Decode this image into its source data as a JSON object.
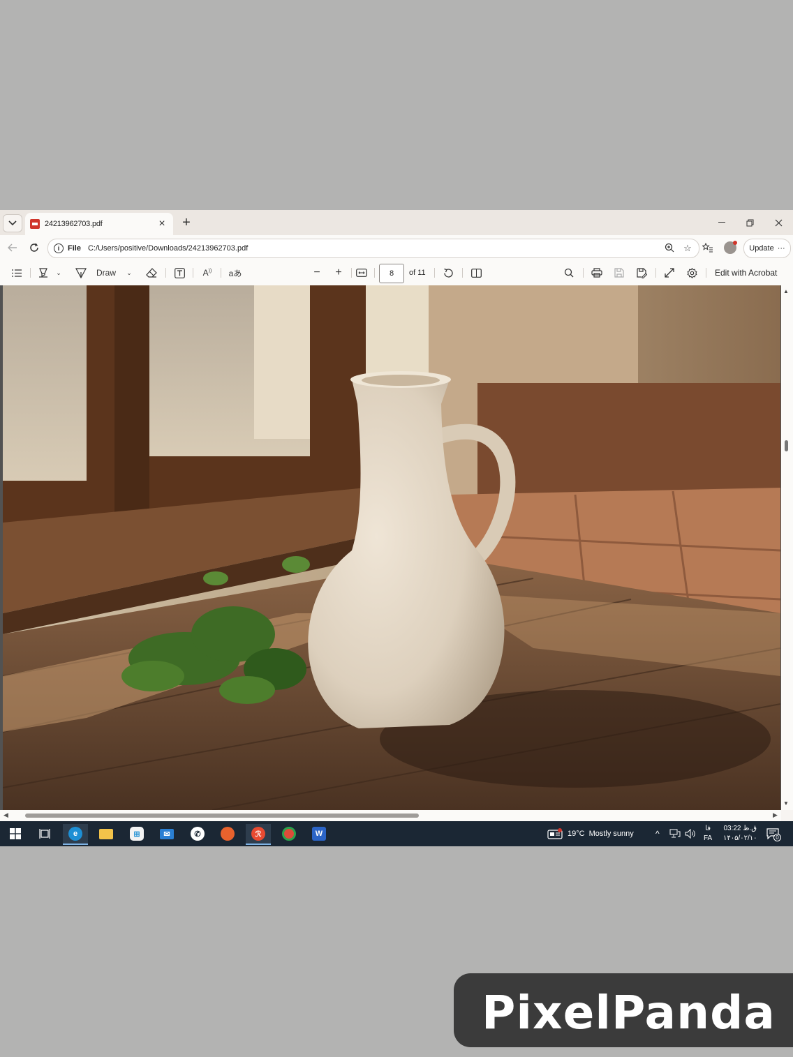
{
  "browser": {
    "tab": {
      "title": "24213962703.pdf"
    },
    "address": {
      "scheme_label": "File",
      "url": "C:/Users/positive/Downloads/24213962703.pdf"
    },
    "update_label": "Update",
    "update_more": "···"
  },
  "pdf_toolbar": {
    "draw_label": "Draw",
    "current_page": "8",
    "page_count_label": "of 11",
    "edit_label": "Edit with Acrobat"
  },
  "document": {
    "image_description_icon": "ceramic-jug-photo"
  },
  "taskbar": {
    "weather_temp": "19°C",
    "weather_text": "Mostly sunny",
    "lang_top": "فا",
    "lang_bottom": "FA",
    "time": "03:22 ق.ظ",
    "date": "۱۴۰۵/۰۲/۱۰",
    "notification_count": "0"
  },
  "watermark": {
    "text": "PixelPanda"
  },
  "colors": {
    "tab_strip": "#ece7e2",
    "toolbar": "#fbfaf8",
    "taskbar": "#1b2734",
    "pdf_red": "#d0352b",
    "backdrop": "#b3b3b2"
  }
}
